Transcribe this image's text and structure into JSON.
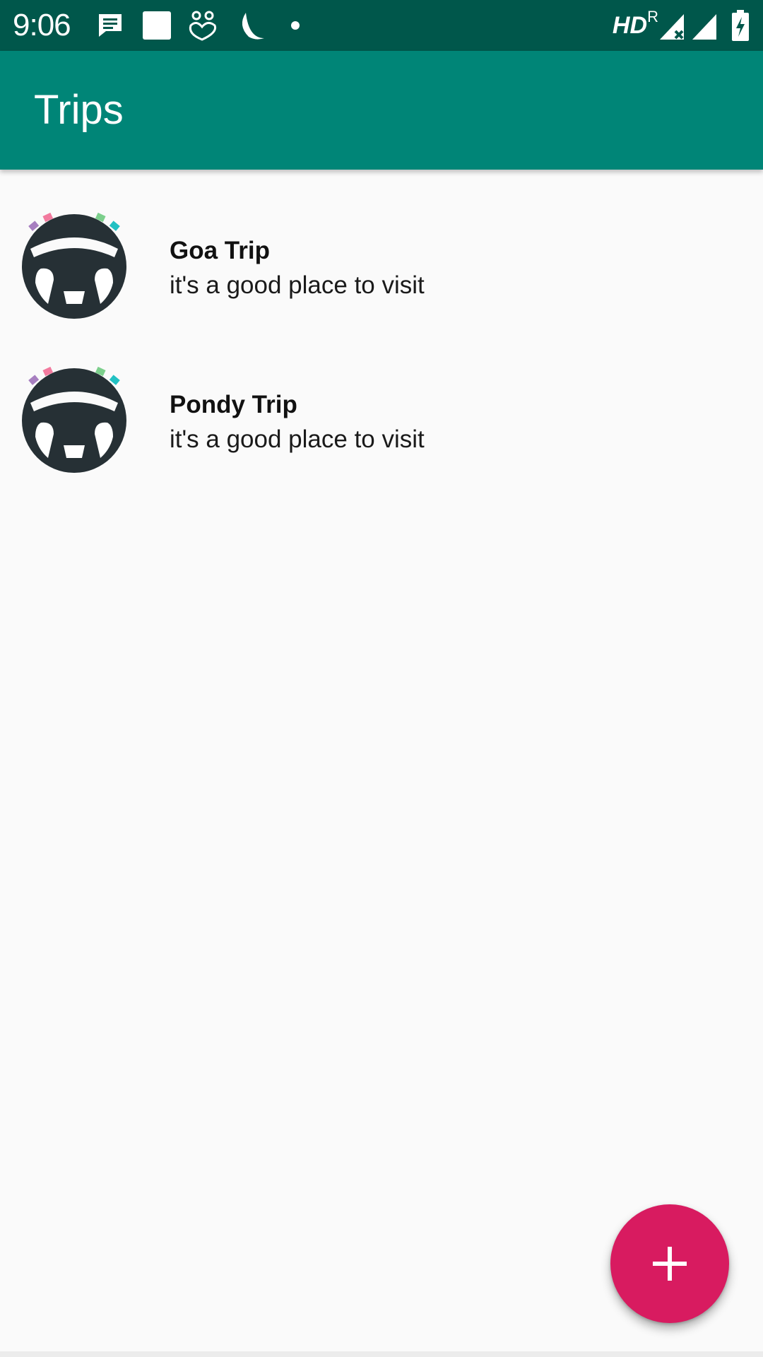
{
  "status_bar": {
    "time": "9:06",
    "network_label": "HD",
    "roaming_label": "R",
    "icons": [
      "message-icon",
      "square-notification-icon",
      "hearts-icon",
      "moon-icon",
      "dot-icon",
      "signal-roaming-icon",
      "signal-icon",
      "battery-charging-icon"
    ]
  },
  "app_bar": {
    "title": "Trips"
  },
  "trips": [
    {
      "title": "Goa Trip",
      "description": "it's a good place to visit",
      "icon": "steering-wheel-icon"
    },
    {
      "title": "Pondy Trip",
      "description": "it's a good place to visit",
      "icon": "steering-wheel-icon"
    }
  ],
  "fab": {
    "icon": "plus-icon"
  },
  "colors": {
    "status_bar": "#00574b",
    "app_bar": "#008577",
    "accent": "#d81b60",
    "background": "#fafafa"
  }
}
